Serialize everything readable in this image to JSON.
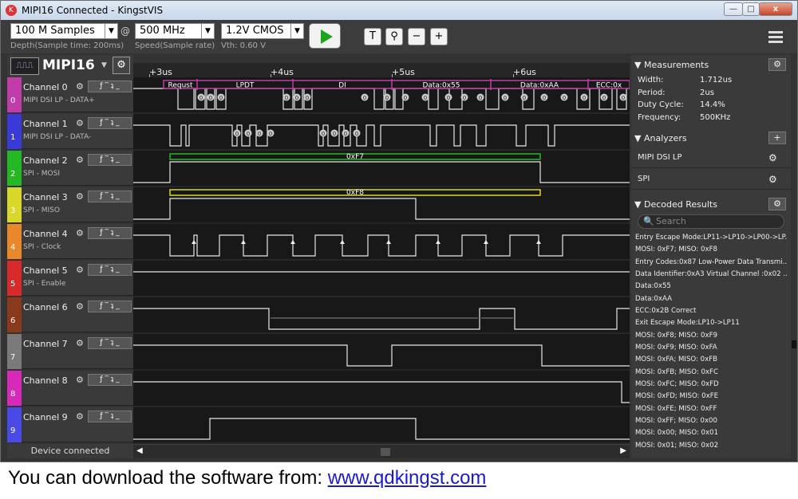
{
  "window": {
    "title": "MIPI16 Connected - KingstVIS",
    "logo_glyph": "K",
    "minimize": "—",
    "maximize": "□",
    "close": "x"
  },
  "toolbar": {
    "depth": "100 M Samples",
    "depth_hint": "Depth(Sample time: 200ms)",
    "at": "@",
    "speed": "500 MHz",
    "speed_hint": "Speed(Sample rate)",
    "vth": "1.2V CMOS",
    "vth_hint": "Vth:  0.60 V",
    "dropdown_arrow": "▼",
    "tool_T": "T",
    "zoom_fit": "⚲",
    "zoom_out": "−",
    "zoom_in": "+"
  },
  "protocol": {
    "icon_label": "⎍⎍⎍",
    "label": "MIPI16",
    "dropdown": "▼",
    "settings": "⚙"
  },
  "ruler": [
    {
      "label": "+3us",
      "t": 3
    },
    {
      "label": "+4us",
      "t": 4
    },
    {
      "label": "+5us",
      "t": 5
    },
    {
      "label": "+6us",
      "t": 6
    }
  ],
  "channels": [
    {
      "index": "0",
      "name": "Channel 0",
      "sub": "MIPI DSI LP - DATA+",
      "color": "#c03ca8"
    },
    {
      "index": "1",
      "name": "Channel 1",
      "sub": "MIPI DSI LP - DATA-",
      "color": "#3a3ad8"
    },
    {
      "index": "2",
      "name": "Channel 2",
      "sub": "SPI - MOSI",
      "color": "#24b824"
    },
    {
      "index": "3",
      "name": "Channel 3",
      "sub": "SPI - MISO",
      "color": "#d8d82a"
    },
    {
      "index": "4",
      "name": "Channel 4",
      "sub": "SPI - Clock",
      "color": "#e8882a"
    },
    {
      "index": "5",
      "name": "Channel 5",
      "sub": "SPI - Enable",
      "color": "#d82a2a"
    },
    {
      "index": "6",
      "name": "Channel 6",
      "sub": "",
      "color": "#8a3a1a"
    },
    {
      "index": "7",
      "name": "Channel 7",
      "sub": "",
      "color": "#7a7a7a"
    },
    {
      "index": "8",
      "name": "Channel 8",
      "sub": "",
      "color": "#d82ab8"
    },
    {
      "index": "9",
      "name": "Channel 9",
      "sub": "",
      "color": "#4a4ae8"
    }
  ],
  "channel_controls": {
    "gear": "⚙",
    "trigger": "ƒ ‾ ʇ _"
  },
  "decode_bars": [
    {
      "label": "Requst"
    },
    {
      "label": "LPDT"
    },
    {
      "label": "DI"
    },
    {
      "label": "Data:0x55"
    },
    {
      "label": "Data:0xAA"
    },
    {
      "label": "ECC:0x"
    }
  ],
  "bit_marker": "0",
  "spi_bars": {
    "mosi": "0xF7",
    "miso": "0xF8"
  },
  "status": "Device connected",
  "scroll": {
    "left": "◀",
    "right": "▶"
  },
  "panel": {
    "collapse_arrow": "▼",
    "measurements_title": "Measurements",
    "measurements": [
      {
        "label": "Width:",
        "value": "1.712us"
      },
      {
        "label": "Period:",
        "value": "2us"
      },
      {
        "label": "Duty Cycle:",
        "value": "14.4%"
      },
      {
        "label": "Frequency:",
        "value": "500KHz"
      }
    ],
    "analyzers_title": "Analyzers",
    "analyzers_add": "+",
    "analyzers": [
      "MIPI DSI LP",
      "SPI"
    ],
    "decoded_title": "Decoded Results",
    "search_placeholder": "Search",
    "search_icon": "🔍",
    "results": [
      "Entry Escape Mode:LP11->LP10->LP00->LP...",
      "MOSI: 0xF7;  MISO: 0xF8",
      "Entry Codes:0x87 Low-Power Data Transmi...",
      "Data Identifier:0xA3 Virtual Channel :0x02 ...",
      "Data:0x55",
      "Data:0xAA",
      "ECC:0x2B Correct",
      "Exit Escape Mode:LP10->LP11",
      "MOSI: 0xF8;  MISO: 0xF9",
      "MOSI: 0xF9;  MISO: 0xFA",
      "MOSI: 0xFA;  MISO: 0xFB",
      "MOSI: 0xFB;  MISO: 0xFC",
      "MOSI: 0xFC;  MISO: 0xFD",
      "MOSI: 0xFD;  MISO: 0xFE",
      "MOSI: 0xFE;  MISO: 0xFF",
      "MOSI: 0xFF;  MISO: 0x00",
      "MOSI: 0x00;  MISO: 0x01",
      "MOSI: 0x01;  MISO: 0x02"
    ]
  },
  "caption": {
    "text": "You can download the software from: ",
    "link": "www.qdkingst.com"
  }
}
